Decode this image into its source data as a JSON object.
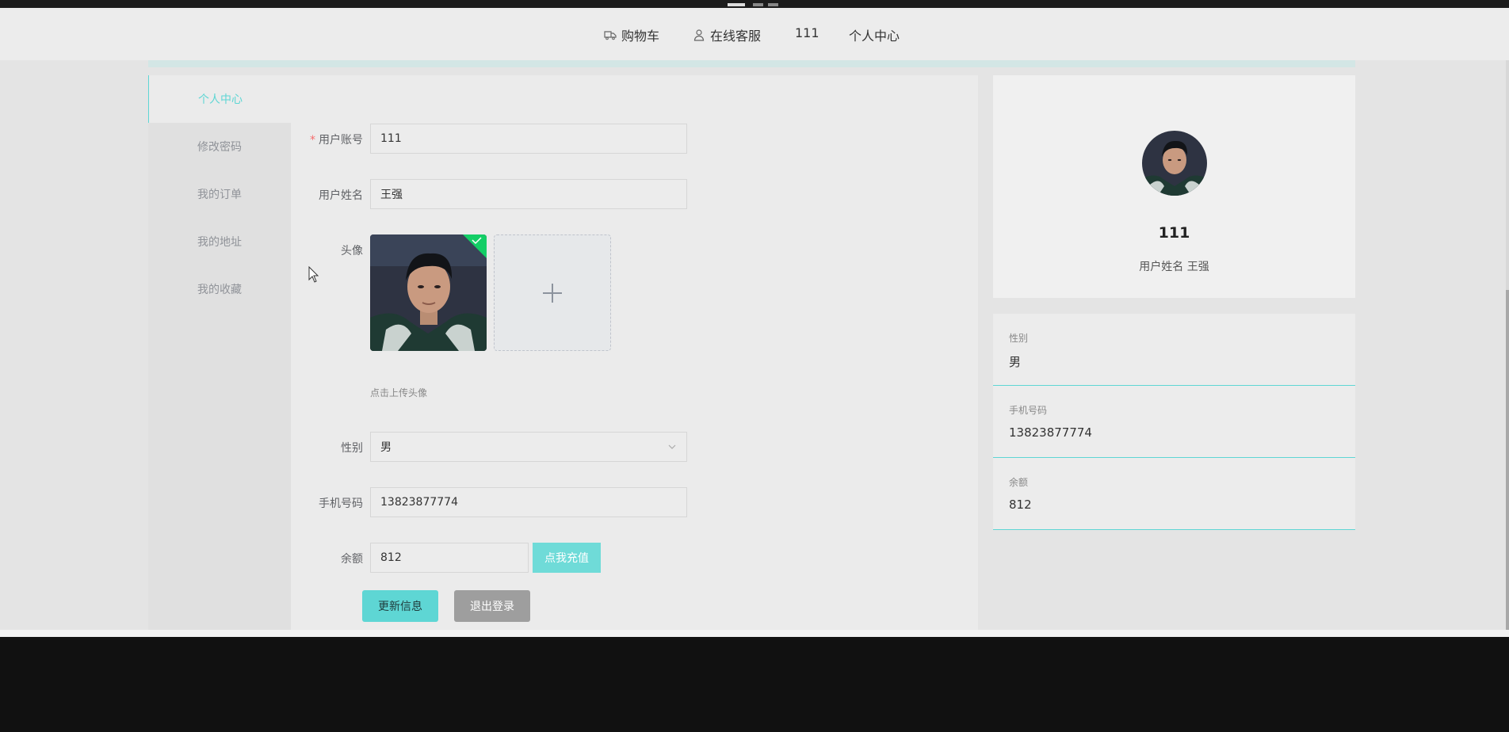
{
  "nav": {
    "cart": "购物车",
    "service": "在线客服",
    "username": "111",
    "personal": "个人中心"
  },
  "sidebar": {
    "items": [
      {
        "label": "个人中心"
      },
      {
        "label": "修改密码"
      },
      {
        "label": "我的订单"
      },
      {
        "label": "我的地址"
      },
      {
        "label": "我的收藏"
      }
    ]
  },
  "form": {
    "account_label": "用户账号",
    "account_value": "111",
    "name_label": "用户姓名",
    "name_value": "王强",
    "avatar_label": "头像",
    "upload_hint": "点击上传头像",
    "gender_label": "性别",
    "gender_value": "男",
    "phone_label": "手机号码",
    "phone_value": "13823877774",
    "balance_label": "余额",
    "balance_value": "812",
    "recharge_button": "点我充值",
    "update_button": "更新信息",
    "logout_button": "退出登录"
  },
  "profile": {
    "username": "111",
    "name_line": "用户姓名 王强",
    "gender_label": "性别",
    "gender_value": "男",
    "phone_label": "手机号码",
    "phone_value": "13823877774",
    "balance_label": "余额",
    "balance_value": "812"
  },
  "colors": {
    "accent": "#5ed6d4",
    "muted_button": "#9e9e9e"
  }
}
